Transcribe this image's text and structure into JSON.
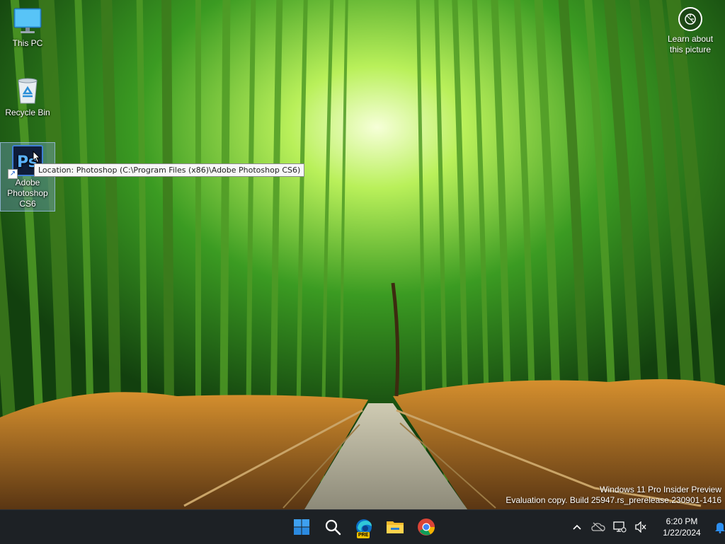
{
  "desktop": {
    "icons": [
      {
        "label": "This PC",
        "icon": "monitor-icon"
      },
      {
        "label": "Recycle Bin",
        "icon": "recycle-bin-icon"
      },
      {
        "label": "Adobe Photoshop CS6",
        "icon": "photoshop-icon",
        "glyph_text": "Ps"
      }
    ],
    "tooltip": "Location: Photoshop (C:\\Program Files (x86)\\Adobe Photoshop CS6)",
    "learn_about_picture": "Learn about this picture",
    "watermark": {
      "line1": "Windows 11 Pro Insider Preview",
      "line2": "Evaluation copy. Build 25947.rs_prerelease.230901-1416"
    }
  },
  "taskbar": {
    "apps": [
      {
        "name": "start",
        "icon": "windows-start-icon"
      },
      {
        "name": "search",
        "icon": "search-icon"
      },
      {
        "name": "edge-preview",
        "icon": "edge-icon",
        "badge": "PRE"
      },
      {
        "name": "file-explorer",
        "icon": "folder-icon"
      },
      {
        "name": "chrome",
        "icon": "chrome-icon"
      }
    ],
    "tray": {
      "icons": [
        "chevron-up-icon",
        "onedrive-icon",
        "network-icon",
        "volume-muted-icon"
      ],
      "time": "6:20 PM",
      "date": "1/22/2024",
      "notification_icon": "bell-icon"
    },
    "colors": {
      "background": "#1d2125",
      "accent": "#0078d4"
    }
  }
}
